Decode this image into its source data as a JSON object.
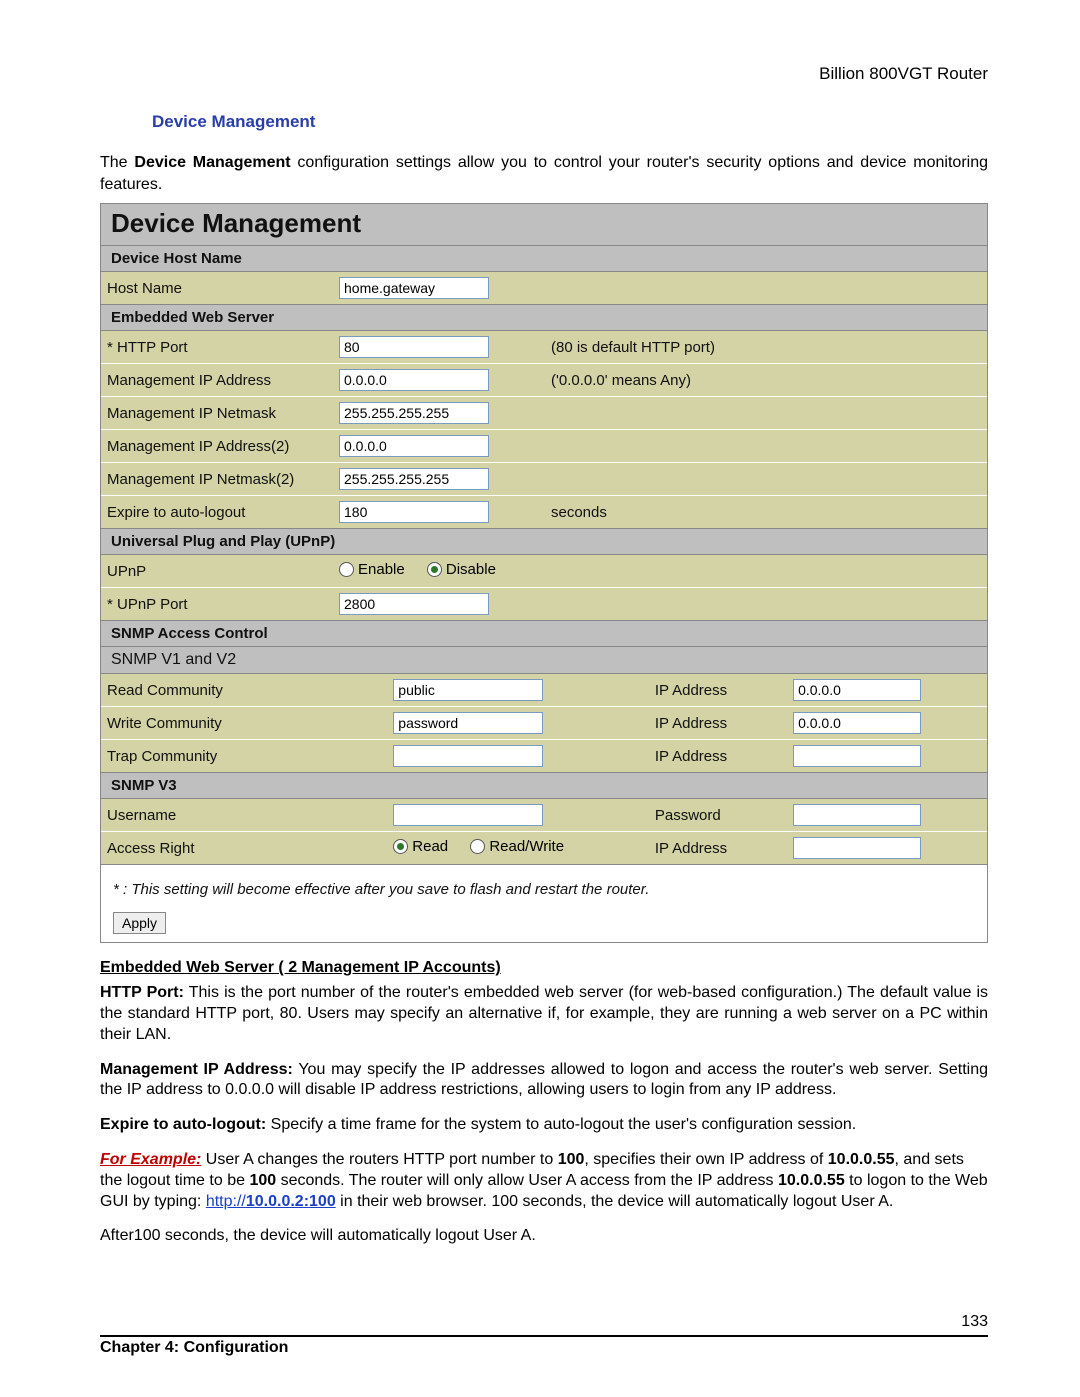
{
  "header": {
    "router_name": "Billion 800VGT Router"
  },
  "section": {
    "title": "Device Management"
  },
  "intro": {
    "text_before": "The ",
    "bold": "Device Management",
    "text_after": " configuration settings allow you to control your router's security options and device monitoring features."
  },
  "panel": {
    "title": "Device Management",
    "host": {
      "group": "Device Host Name",
      "host_name_label": "Host Name",
      "host_name_value": "home.gateway"
    },
    "web": {
      "group": "Embedded Web Server",
      "http_port_label": "* HTTP Port",
      "http_port_value": "80",
      "http_port_hint": "(80 is default HTTP port)",
      "mgmt_ip_label": "Management IP Address",
      "mgmt_ip_value": "0.0.0.0",
      "mgmt_ip_hint": "('0.0.0.0' means Any)",
      "mgmt_mask_label": "Management IP Netmask",
      "mgmt_mask_value": "255.255.255.255",
      "mgmt_ip2_label": "Management IP Address(2)",
      "mgmt_ip2_value": "0.0.0.0",
      "mgmt_mask2_label": "Management IP Netmask(2)",
      "mgmt_mask2_value": "255.255.255.255",
      "expire_label": "Expire to auto-logout",
      "expire_value": "180",
      "expire_hint": "seconds"
    },
    "upnp": {
      "group": "Universal Plug and Play (UPnP)",
      "upnp_label": "UPnP",
      "enable_label": "Enable",
      "disable_label": "Disable",
      "selected": "disable",
      "port_label": "* UPnP Port",
      "port_value": "2800"
    },
    "snmp": {
      "group": "SNMP Access Control",
      "v12_title": "SNMP V1 and V2",
      "read_label": "Read Community",
      "read_value": "public",
      "ip_label": "IP Address",
      "read_ip": "0.0.0.0",
      "write_label": "Write Community",
      "write_value": "password",
      "write_ip": "0.0.0.0",
      "trap_label": "Trap Community",
      "trap_value": "",
      "trap_ip": "",
      "v3_title": "SNMP V3",
      "user_label": "Username",
      "user_value": "",
      "pass_label": "Password",
      "pass_value": "",
      "access_label": "Access Right",
      "access_read": "Read",
      "access_rw": "Read/Write",
      "access_selected": "read",
      "access_ip": ""
    },
    "note": "* : This setting will become effective after you save to flash and restart the router.",
    "apply": "Apply"
  },
  "body": {
    "sub1": "Embedded Web Server ( 2 Management IP Accounts)",
    "p1_b": "HTTP Port:",
    "p1": " This is the port number of the router's embedded web server (for web-based configuration.) The default value is the standard HTTP port, 80. Users may specify an alternative if, for example, they are running a web server on a PC within their LAN.",
    "p2_b": "Management IP Address:",
    "p2": " You may specify the IP addresses allowed to logon and access the router's web server. Setting the IP address to 0.0.0.0 will disable IP address restrictions, allowing users to login from any IP address.",
    "p3_b": "Expire to auto-logout:",
    "p3": " Specify a time frame for the system to auto-logout the user's configuration session.",
    "ex_lead": "For Example:",
    "ex_1a": " User A changes the routers HTTP port number to ",
    "ex_1b": "100",
    "ex_1c": ", specifies their own IP address of",
    "ex_2a": "10.0.0.55",
    "ex_2b": ", and sets the logout time to be ",
    "ex_2c": "100",
    "ex_2d": " seconds.       The router will only allow User A access from the IP address ",
    "ex_3a": "10.0.0.55",
    "ex_3b": " to logon to the Web GUI by typing: ",
    "ex_link_pre": "http://",
    "ex_link_bold": "10.0.0.2:100",
    "ex_3c": " in their web browser. 100 seconds, the device will automatically logout User A.",
    "after": "After100 seconds, the device will automatically logout User A."
  },
  "footer": {
    "page": "133",
    "chapter": "Chapter 4: Configuration"
  }
}
